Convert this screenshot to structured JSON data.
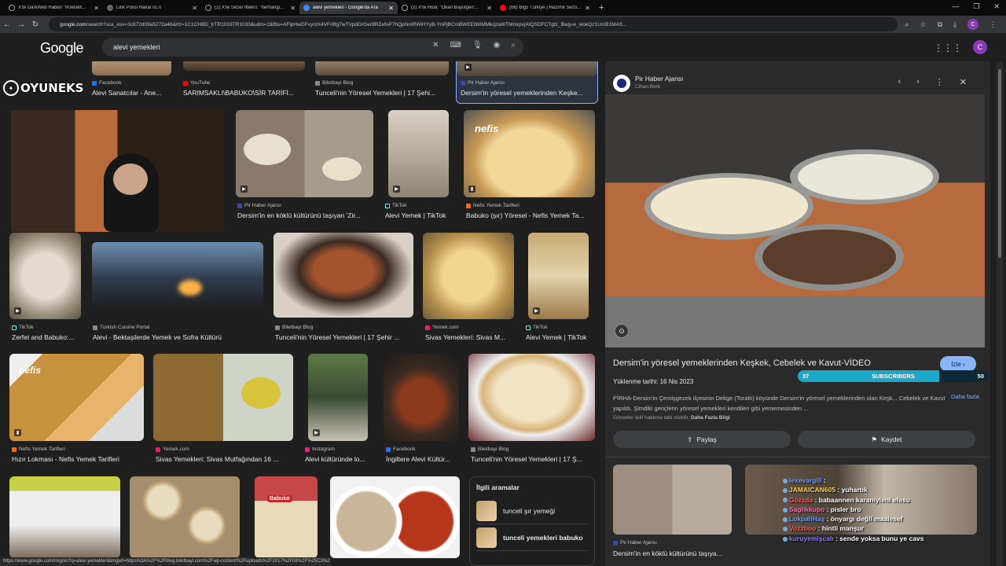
{
  "tabs": [
    {
      "title": "X'te DarkWeb Haben \"#UefaM...",
      "icon": "x-icon",
      "active": false
    },
    {
      "title": "Link Polisi Hakat v1.0",
      "icon": "page-icon",
      "active": false
    },
    {
      "title": "(2) X'te Sezer İlteknı: \"herhangi...",
      "icon": "x-icon",
      "active": false
    },
    {
      "title": "alevi yemekleri - Google'da Ara",
      "icon": "google-icon",
      "active": true
    },
    {
      "title": "(2) X'te Hola: \"Okan Bayülgen'...",
      "icon": "x-icon",
      "active": false
    },
    {
      "title": "(66) Big5 Türkiye | Hazırlık Sezo...",
      "icon": "youtube-icon",
      "active": false
    }
  ],
  "address": {
    "domain": "google.com",
    "path": "/search?sca_esv=3c872d09a5272a46&rlz=1C1CHBD_trTR1033TR1033&udm=2&fbs=AFlpHwGFvyntX4VFr8fg7wTVpdGrGer8RZefoP7hQpNmRWiHYyB-YnPjBCmBWEEtWiMMkrjzaWTMmrpvjAtQSDFCTgtz_Bwg-w_wokQz1UmB1MAS..."
  },
  "search": {
    "logo": "Google",
    "query": "alevi yemekleri"
  },
  "profile_initial": "C",
  "grid": {
    "row0": [
      {
        "source": "Facebook",
        "caption": "Alevi Sanatcılar - Ane..."
      },
      {
        "source": "YouTube",
        "caption": "SARIMSAKLI\\BABUKO\\SİR TARİFİ..."
      },
      {
        "source": "Biletbayi Blog",
        "caption": "Tunceli'nin Yöresel Yemekleri | 17 Şehi..."
      },
      {
        "source": "Pir Haber Ajansı",
        "caption": "Dersim'in yöresel yemeklerinden Keşke..."
      }
    ],
    "row1": [
      {
        "source": "Pir Haber Ajansı",
        "caption": "Dersim'in en köklü kültürünü taşıyan 'Zir..."
      },
      {
        "source": "TikTok",
        "caption": "Alevi Yemek | TikTok"
      },
      {
        "source": "Nefis Yemek Tarifleri",
        "caption": "Babuko (şır) Yöresel - Nefis Yemek Ta..."
      }
    ],
    "row2": [
      {
        "source": "TikTok",
        "caption": "Zerfet and Babuko:..."
      },
      {
        "source": "Turkish Cuisine Portal",
        "caption": "Alevi - Bektaşilerde Yemek ve Sofra Kültürü"
      },
      {
        "source": "Biletbayi Blog",
        "caption": "Tunceli'nin Yöresel Yemekleri | 17 Şehir ..."
      },
      {
        "source": "Yemek.com",
        "caption": "Sivas Yemekleri: Sivas M..."
      },
      {
        "source": "TikTok",
        "caption": "Alevi Yemek | TikTok"
      }
    ],
    "row3": [
      {
        "source": "Nefis Yemek Tarifleri",
        "caption": "Hızır Lokması - Nefis Yemek Tarifleri"
      },
      {
        "source": "Yemek.com",
        "caption": "Sivas Yemekleri: Sivas Mutfağından 16 ..."
      },
      {
        "source": "Instagram",
        "caption": "Alevi kültüründe lo..."
      },
      {
        "source": "Facebook",
        "caption": "İngiltere Alevi Kültür..."
      },
      {
        "source": "Biletbayi Blog",
        "caption": "Tunceli'nin Yöresel Yemekleri | 17 Ş..."
      }
    ]
  },
  "related": {
    "title": "İlgili aramalar",
    "items": [
      "tunceli şır yemeği",
      "tunceli yemekleri babuko"
    ]
  },
  "overlay": {
    "watermark": "OYUNEKS",
    "row4_banner_text": "Babuko"
  },
  "panel": {
    "publisher": "Pir Haber Ajansı",
    "author": "Cihan Berk",
    "title": "Dersim'in yöresel yemeklerinden Keşkek, Cebelek ve Kavut-VİDEO",
    "watch_label": "İzle",
    "upload_date": "Yüklenme tarihi: 16 Nis 2023",
    "description": "PİRHA-Dersim'in Çemişgezek ilçesinin Dekge (Toratlı) köyünde Dersim'in yöresel yemeklerinden olan Keşk... Cebelek ve Kavut yapıldı. Şimdiki gençlerin yöresel yemekleri kendileri gibi yememesinden ...",
    "more_label": "Daha fazla",
    "note": "Görseller telif hakkına tabi olabilir.",
    "more_info": "Daha Fazla Bilgi",
    "share_label": "Paylaş",
    "save_label": "Kaydet",
    "related_source": "Pir Haber Ajansı",
    "related_caption": "Dersim'in en köklü kültürünü taşıya..."
  },
  "subscribers": {
    "current": "37",
    "label": "SUBSCRIBERS",
    "goal": "50",
    "progress": 0.74
  },
  "chat": [
    {
      "user": "lexevargill",
      "msg": ""
    },
    {
      "user": "JAMAICAN605",
      "msg": "yuhartık"
    },
    {
      "user": "Gozzda",
      "msg": "babaannen karaniyleni efesu"
    },
    {
      "user": "Saglikkupo",
      "msg": "pisler bro"
    },
    {
      "user": "LokpaliHaş",
      "msg": "önyargı değil maalesef"
    },
    {
      "user": "Vozzboo",
      "msg": "hintli manşur"
    },
    {
      "user": "kuruyemişcalı",
      "msg": "sende yoksa bunu ye cavs"
    }
  ],
  "status_url": "https://www.google.com/imgres?q=alevi yemekleri&imgurl=https%3A%2F%2Fblog.biletbayi.com%2Fwp-content%2Fuploads%2F2017%2F08%2F%25C3%25..."
}
